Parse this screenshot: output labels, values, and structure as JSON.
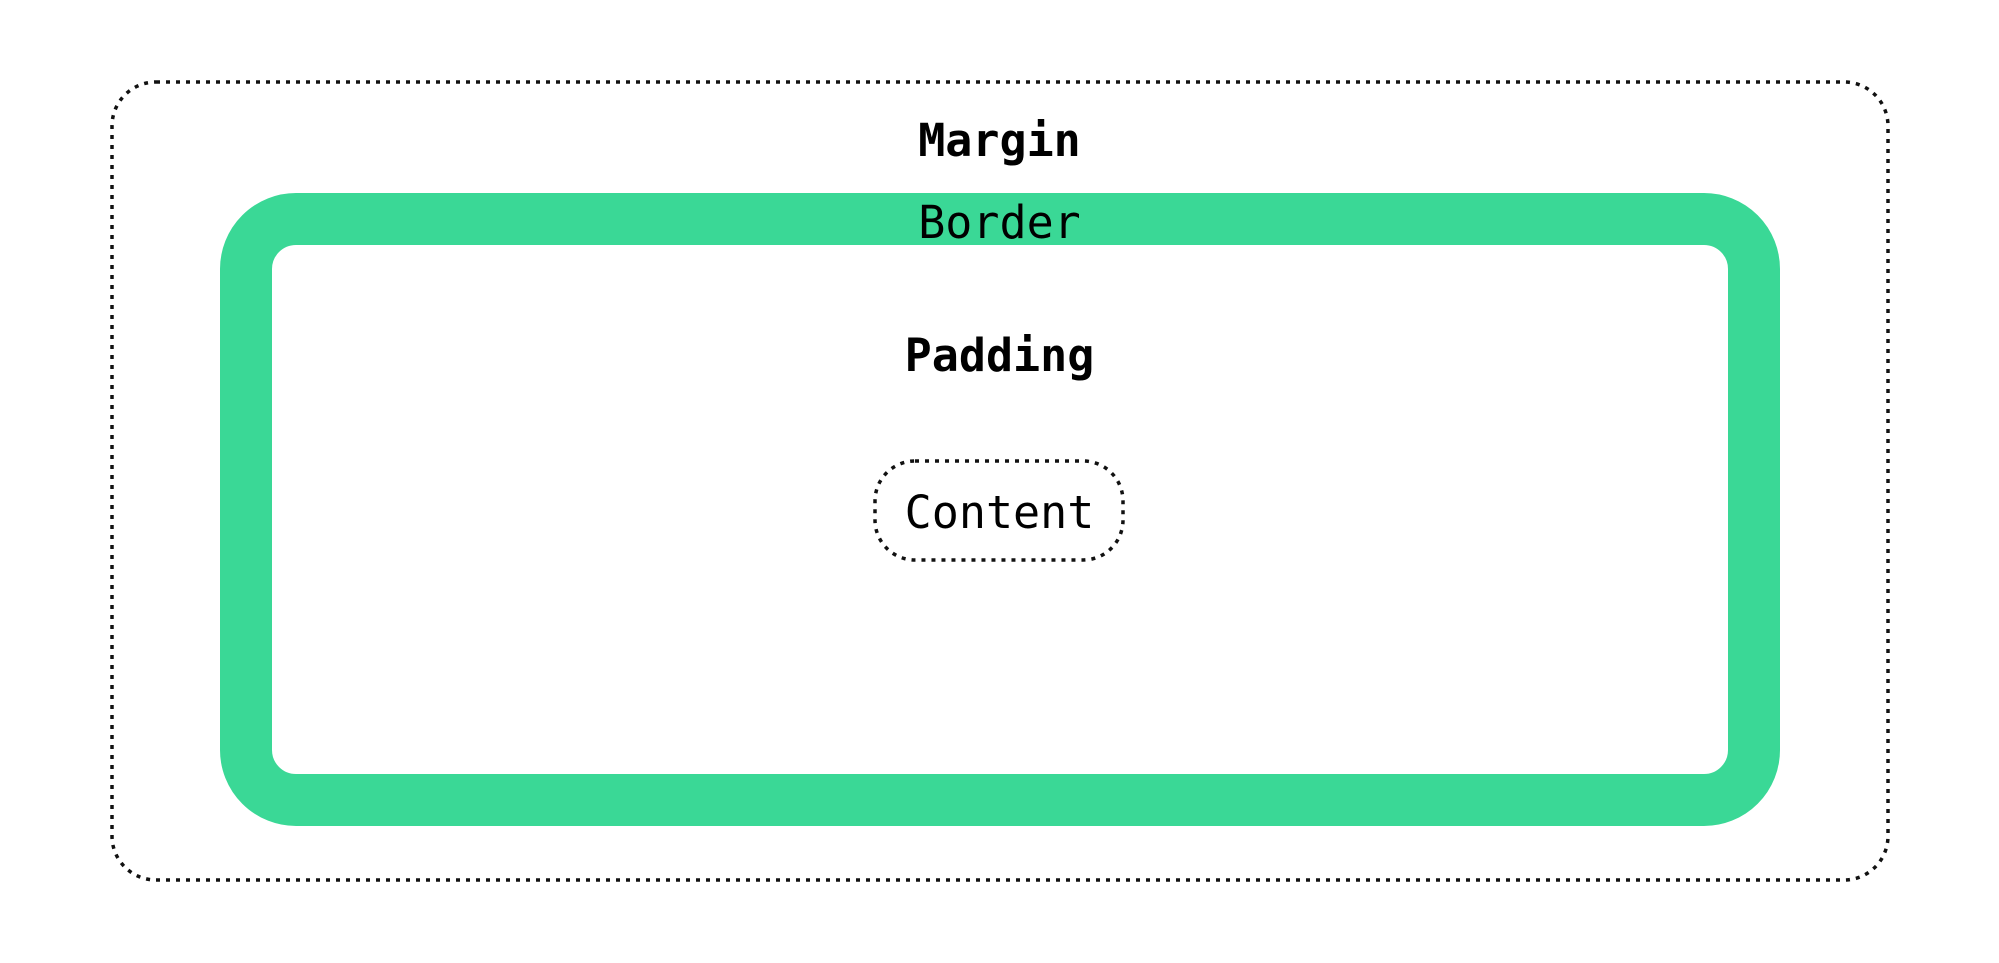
{
  "diagram": {
    "margin_label": "Margin",
    "border_label": "Border",
    "padding_label": "Padding",
    "content_label": "Content"
  },
  "colors": {
    "border": "#3ad896",
    "outline": "#111111",
    "background": "#ffffff",
    "text": "#000000"
  }
}
